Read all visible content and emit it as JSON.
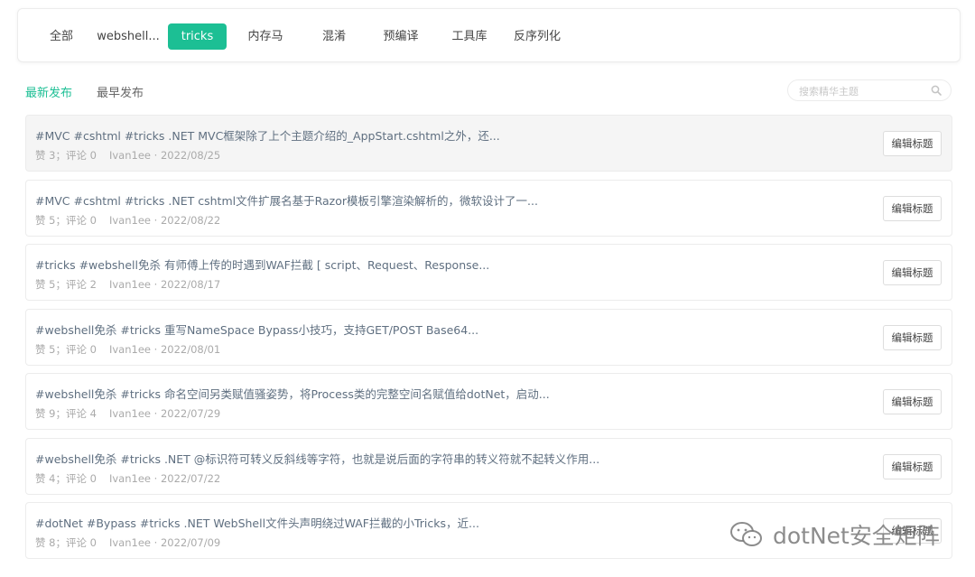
{
  "tabs": [
    {
      "label": "全部",
      "active": false
    },
    {
      "label": "webshell...",
      "active": false
    },
    {
      "label": "tricks",
      "active": true
    },
    {
      "label": "内存马",
      "active": false
    },
    {
      "label": "混淆",
      "active": false
    },
    {
      "label": "预编译",
      "active": false
    },
    {
      "label": "工具库",
      "active": false
    },
    {
      "label": "反序列化",
      "active": false
    }
  ],
  "sort": {
    "newest": "最新发布",
    "oldest": "最早发布"
  },
  "search": {
    "placeholder": "搜索精华主题"
  },
  "edit_label": "编辑标题",
  "posts": [
    {
      "title": "#MVC #cshtml #tricks .NET MVC框架除了上个主题介绍的_AppStart.cshtml之外，还...",
      "likes": "赞 3",
      "comments": "评论 0",
      "author": "Ivan1ee",
      "date": "2022/08/25"
    },
    {
      "title": "#MVC #cshtml #tricks .NET cshtml文件扩展名基于Razor模板引擎渲染解析的，微软设计了一...",
      "likes": "赞 5",
      "comments": "评论 0",
      "author": "Ivan1ee",
      "date": "2022/08/22"
    },
    {
      "title": "#tricks #webshell免杀 有师傅上传的时遇到WAF拦截 [ script、Request、Response...",
      "likes": "赞 5",
      "comments": "评论 2",
      "author": "Ivan1ee",
      "date": "2022/08/17"
    },
    {
      "title": "#webshell免杀 #tricks 重写NameSpace Bypass小技巧，支持GET/POST Base64...",
      "likes": "赞 5",
      "comments": "评论 0",
      "author": "Ivan1ee",
      "date": "2022/08/01"
    },
    {
      "title": "#webshell免杀 #tricks 命名空间另类赋值骚姿势，将Process类的完整空间名赋值给dotNet，启动...",
      "likes": "赞 9",
      "comments": "评论 4",
      "author": "Ivan1ee",
      "date": "2022/07/29"
    },
    {
      "title": "#webshell免杀 #tricks .NET @标识符可转义反斜线等字符，也就是说后面的字符串的转义符就不起转义作用...",
      "likes": "赞 4",
      "comments": "评论 0",
      "author": "Ivan1ee",
      "date": "2022/07/22"
    },
    {
      "title": "#dotNet #Bypass #tricks .NET WebShell文件头声明绕过WAF拦截的小Tricks，近...",
      "likes": "赞 8",
      "comments": "评论 0",
      "author": "Ivan1ee",
      "date": "2022/07/09"
    }
  ],
  "watermark": "dotNet安全矩阵",
  "colors": {
    "accent": "#1cbf94",
    "title_text": "#5f6f80",
    "meta_text": "#aaaaaa"
  }
}
